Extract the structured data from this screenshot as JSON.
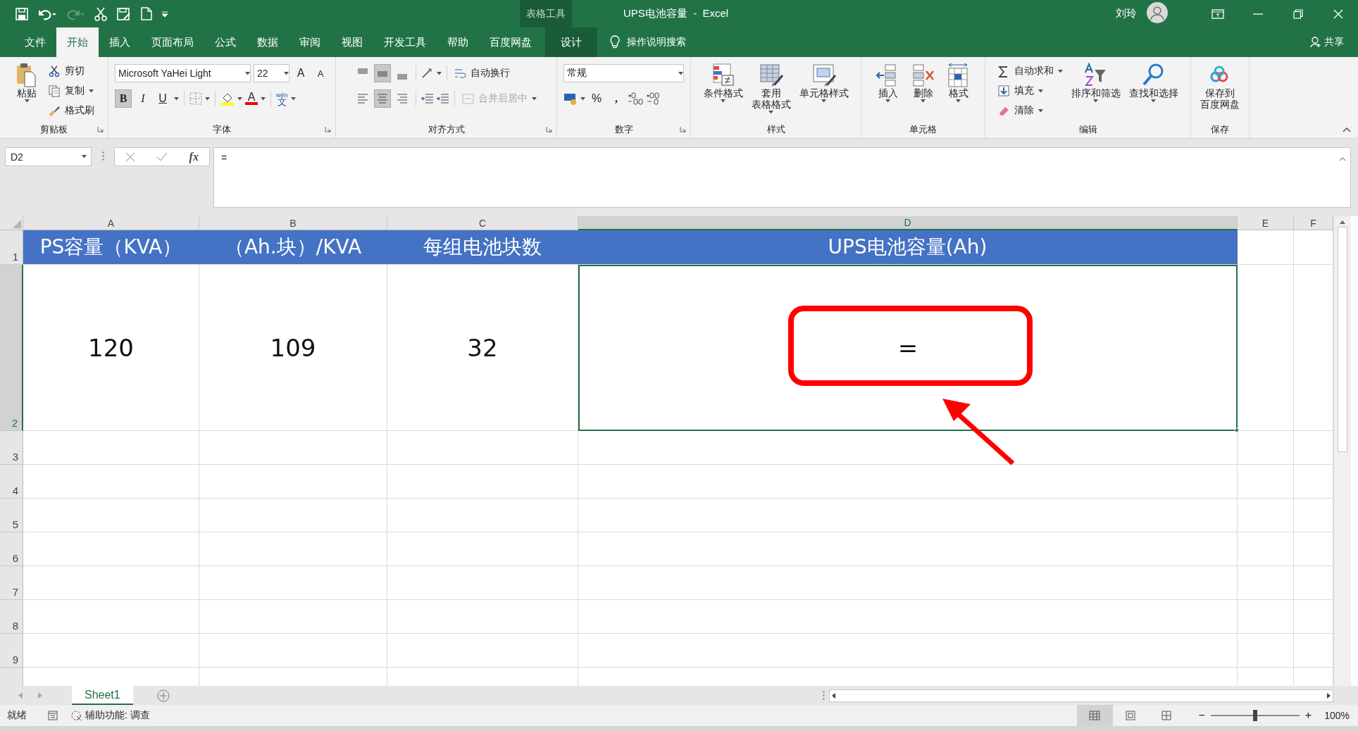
{
  "title_bar": {
    "context_label": "表格工具",
    "title": "UPS电池容量  -  Excel",
    "user": "刘玲"
  },
  "ribbon_tabs": [
    {
      "label": "文件",
      "selected": false,
      "contextual": false
    },
    {
      "label": "开始",
      "selected": true,
      "contextual": false
    },
    {
      "label": "插入",
      "selected": false,
      "contextual": false
    },
    {
      "label": "页面布局",
      "selected": false,
      "contextual": false
    },
    {
      "label": "公式",
      "selected": false,
      "contextual": false
    },
    {
      "label": "数据",
      "selected": false,
      "contextual": false
    },
    {
      "label": "审阅",
      "selected": false,
      "contextual": false
    },
    {
      "label": "视图",
      "selected": false,
      "contextual": false
    },
    {
      "label": "开发工具",
      "selected": false,
      "contextual": false
    },
    {
      "label": "帮助",
      "selected": false,
      "contextual": false
    },
    {
      "label": "百度网盘",
      "selected": false,
      "contextual": false
    },
    {
      "label": "设计",
      "selected": false,
      "contextual": true
    }
  ],
  "tell_me": "操作说明搜索",
  "share": "共享",
  "ribbon": {
    "groups": [
      {
        "kind": "buttons",
        "label": "剪贴板",
        "launcher": true,
        "items": [
          {
            "kind": "large",
            "lines": [
              "粘贴"
            ],
            "dropdown": true
          },
          {
            "kind": "stack",
            "items": [
              {
                "label": "剪切",
                "dropdown": false,
                "disabled": false
              },
              {
                "label": "复制",
                "dropdown": true,
                "disabled": false
              },
              {
                "label": "格式刷",
                "dropdown": false,
                "disabled": false
              }
            ]
          }
        ]
      },
      {
        "kind": "font",
        "label": "字体",
        "launcher": true,
        "font_name": "Microsoft YaHei Light",
        "font_size": "22",
        "grow": "A",
        "shrink": "A",
        "bold": {
          "text": "B",
          "on": true
        },
        "italic": {
          "text": "I",
          "on": false
        },
        "underline": {
          "text": "U",
          "on": false
        },
        "font_color": "A",
        "phonetic_top": "wén",
        "phonetic_char": "文"
      },
      {
        "kind": "alignment",
        "label": "对齐方式",
        "launcher": true,
        "vertical_align": [
          {
            "selected": false
          },
          {
            "selected": true
          },
          {
            "selected": false
          }
        ],
        "horizontal_align": [
          {
            "selected": false
          },
          {
            "selected": true
          },
          {
            "selected": false
          }
        ],
        "wrap_text": "自动换行",
        "merge": {
          "label": "合并后居中",
          "disabled": true
        }
      },
      {
        "kind": "number",
        "label": "数字",
        "launcher": true,
        "format": "常规",
        "percent": "%",
        "comma": ","
      },
      {
        "kind": "buttons",
        "label": "样式",
        "launcher": false,
        "items": [
          {
            "kind": "large",
            "lines": [
              "条件格式"
            ],
            "dropdown": true
          },
          {
            "kind": "large",
            "lines": [
              "套用",
              "表格格式"
            ],
            "dropdown": true
          },
          {
            "kind": "large",
            "lines": [
              "单元格样式"
            ],
            "dropdown": true
          }
        ]
      },
      {
        "kind": "buttons",
        "label": "单元格",
        "launcher": false,
        "items": [
          {
            "kind": "large",
            "lines": [
              "插入"
            ],
            "dropdown": true
          },
          {
            "kind": "large",
            "lines": [
              "删除"
            ],
            "dropdown": true
          },
          {
            "kind": "large",
            "lines": [
              "格式"
            ],
            "dropdown": true
          }
        ]
      },
      {
        "kind": "buttons",
        "label": "编辑",
        "launcher": false,
        "items": [
          {
            "kind": "stack",
            "items": [
              {
                "label": "自动求和",
                "dropdown": true,
                "disabled": false
              },
              {
                "label": "填充",
                "dropdown": true,
                "disabled": false
              },
              {
                "label": "清除",
                "dropdown": true,
                "disabled": false
              }
            ]
          },
          {
            "kind": "large",
            "lines": [
              "排序和筛选"
            ],
            "dropdown": true
          },
          {
            "kind": "large",
            "lines": [
              "查找和选择"
            ],
            "dropdown": true
          }
        ]
      },
      {
        "kind": "buttons",
        "label": "保存",
        "launcher": false,
        "items": [
          {
            "kind": "large",
            "lines": [
              "保存到",
              "百度网盘"
            ],
            "dropdown": false
          }
        ]
      }
    ]
  },
  "formula_bar": {
    "name_box": "D2",
    "fx": "fx",
    "formula": "="
  },
  "sheet": {
    "columns": [
      {
        "label": "A",
        "selected": false
      },
      {
        "label": "B",
        "selected": false
      },
      {
        "label": "C",
        "selected": false
      },
      {
        "label": "D",
        "selected": true
      },
      {
        "label": "E",
        "selected": false
      },
      {
        "label": "F",
        "selected": false
      }
    ],
    "rows": [
      {
        "label": "1",
        "selected": false,
        "cells": [
          {
            "text": "PS容量（KVA）",
            "header": true,
            "active": false
          },
          {
            "text": "（Ah.块）/KVA",
            "header": true,
            "active": false
          },
          {
            "text": "每组电池块数",
            "header": true,
            "active": false
          },
          {
            "text": "UPS电池容量(Ah)",
            "header": true,
            "active": false
          }
        ]
      },
      {
        "label": "2",
        "selected": true,
        "cells": [
          {
            "text": "120",
            "header": false,
            "active": false
          },
          {
            "text": "109",
            "header": false,
            "active": false
          },
          {
            "text": "32",
            "header": false,
            "active": false
          },
          {
            "text": "=",
            "header": false,
            "active": true
          }
        ]
      },
      {
        "label": "3",
        "selected": false,
        "cells": []
      },
      {
        "label": "4",
        "selected": false,
        "cells": []
      },
      {
        "label": "5",
        "selected": false,
        "cells": []
      },
      {
        "label": "6",
        "selected": false,
        "cells": []
      },
      {
        "label": "7",
        "selected": false,
        "cells": []
      },
      {
        "label": "8",
        "selected": false,
        "cells": []
      },
      {
        "label": "9",
        "selected": false,
        "cells": []
      }
    ]
  },
  "annotations": {
    "highlight_box": true,
    "arrow": true
  },
  "sheet_tabs": [
    {
      "label": "Sheet1",
      "selected": true
    }
  ],
  "status_bar": {
    "mode": "就绪",
    "accessibility": "辅助功能: 调查",
    "views": [
      {
        "selected": true
      },
      {
        "selected": false
      },
      {
        "selected": false
      }
    ],
    "zoom_out": "−",
    "zoom_in": "+",
    "zoom": {
      "level": 0.5
    },
    "zoom_text": "100%"
  }
}
